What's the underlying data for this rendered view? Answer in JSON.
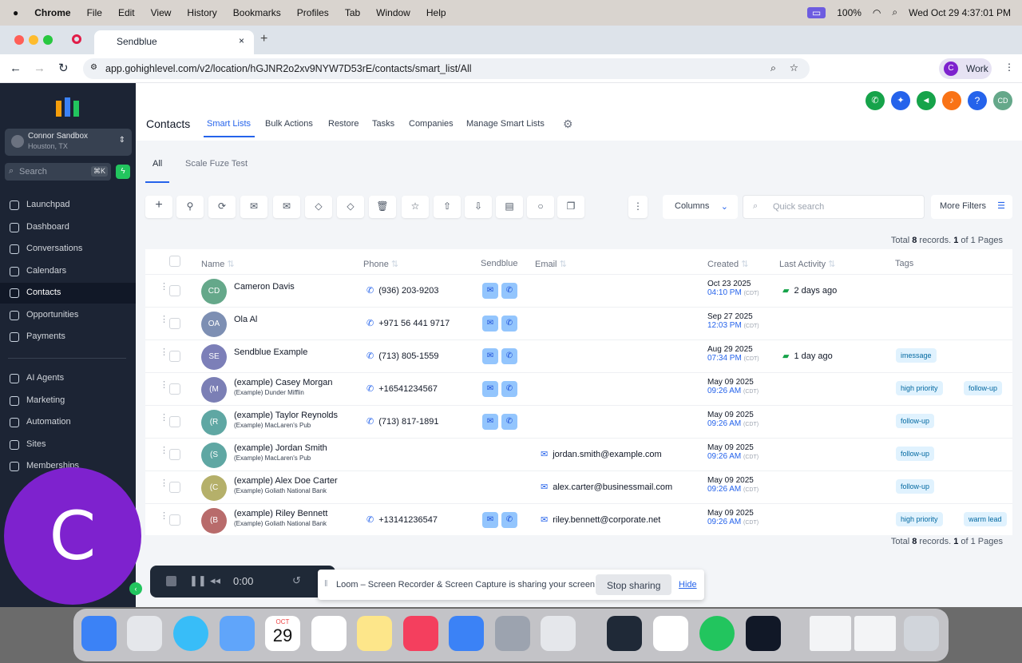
{
  "menubar": {
    "app": "Chrome",
    "items": [
      "File",
      "Edit",
      "View",
      "History",
      "Bookmarks",
      "Profiles",
      "Tab",
      "Window",
      "Help"
    ],
    "battery": "100%",
    "datetime": "Wed Oct 29  4:37:01 PM"
  },
  "browser": {
    "tab_title": "Sendblue",
    "url": "app.gohighlevel.com/v2/location/hGJNR2o2xv9NYW7D53rE/contacts/smart_list/All",
    "profile_letter": "C",
    "profile_label": "Work"
  },
  "sidebar": {
    "account_name": "Connor Sandbox",
    "account_location": "Houston, TX",
    "search_placeholder": "Search",
    "search_shortcut": "⌘K",
    "items": [
      "Launchpad",
      "Dashboard",
      "Conversations",
      "Calendars",
      "Contacts",
      "Opportunities",
      "Payments"
    ],
    "items2": [
      "AI Agents",
      "Marketing",
      "Automation",
      "Sites",
      "Memberships"
    ]
  },
  "header": {
    "title": "Contacts",
    "tabs": [
      "Smart Lists",
      "Bulk Actions",
      "Restore",
      "Tasks",
      "Companies",
      "Manage Smart Lists"
    ],
    "avatar": "CD"
  },
  "subtabs": [
    "All",
    "Scale Fuze Test"
  ],
  "toolbar": {
    "columns": "Columns",
    "quick_search": "Quick search",
    "more_filters": "More Filters"
  },
  "totals": {
    "prefix": "Total",
    "count": "8",
    "records": "records.",
    "page": "1",
    "of": "of 1 Pages"
  },
  "table": {
    "headers": [
      "Name",
      "Phone",
      "Sendblue",
      "Email",
      "Created",
      "Last Activity",
      "Tags"
    ],
    "rows": [
      {
        "initials": "CD",
        "color": "#65a88a",
        "name": "Cameron Davis",
        "company": "",
        "phone": "(936) 203-9203",
        "sendblue": true,
        "email": "",
        "date": "Oct 23 2025",
        "time": "04:10 PM",
        "tz": "(CDT)",
        "activity": "2 days ago",
        "tags": []
      },
      {
        "initials": "OA",
        "color": "#7d8fb3",
        "name": "Ola Al",
        "company": "",
        "phone": "+971 56 441 9717",
        "sendblue": true,
        "email": "",
        "date": "Sep 27 2025",
        "time": "12:03 PM",
        "tz": "(CDT)",
        "activity": "",
        "tags": []
      },
      {
        "initials": "SE",
        "color": "#7c7fb8",
        "name": "Sendblue Example",
        "company": "",
        "phone": "(713) 805-1559",
        "sendblue": true,
        "email": "",
        "date": "Aug 29 2025",
        "time": "07:34 PM",
        "tz": "(CDT)",
        "activity": "1 day ago",
        "tags": [
          "imessage"
        ]
      },
      {
        "initials": "(M",
        "color": "#7b7fb5",
        "name": "(example) Casey Morgan",
        "company": "(Example) Dunder Mifflin",
        "phone": "+16541234567",
        "sendblue": true,
        "email": "",
        "date": "May 09 2025",
        "time": "09:26 AM",
        "tz": "(CDT)",
        "activity": "",
        "tags": [
          "high priority",
          "follow-up"
        ]
      },
      {
        "initials": "(R",
        "color": "#5fa7a3",
        "name": "(example) Taylor Reynolds",
        "company": "(Example) MacLaren's Pub",
        "phone": "(713) 817-1891",
        "sendblue": true,
        "email": "",
        "date": "May 09 2025",
        "time": "09:26 AM",
        "tz": "(CDT)",
        "activity": "",
        "tags": [
          "follow-up"
        ]
      },
      {
        "initials": "(S",
        "color": "#5fa7a3",
        "name": "(example) Jordan Smith",
        "company": "(Example) MacLaren's Pub",
        "phone": "",
        "sendblue": false,
        "email": "jordan.smith@example.com",
        "date": "May 09 2025",
        "time": "09:26 AM",
        "tz": "(CDT)",
        "activity": "",
        "tags": [
          "follow-up"
        ]
      },
      {
        "initials": "(C",
        "color": "#b5b06a",
        "name": "(example) Alex Doe Carter",
        "company": "(Example) Goliath National Bank",
        "phone": "",
        "sendblue": false,
        "email": "alex.carter@businessmail.com",
        "date": "May 09 2025",
        "time": "09:26 AM",
        "tz": "(CDT)",
        "activity": "",
        "tags": [
          "follow-up"
        ]
      },
      {
        "initials": "(B",
        "color": "#b86b6b",
        "name": "(example) Riley Bennett",
        "company": "(Example) Goliath National Bank",
        "phone": "+13141236547",
        "sendblue": true,
        "email": "riley.bennett@corporate.net",
        "date": "May 09 2025",
        "time": "09:26 AM",
        "tz": "(CDT)",
        "activity": "",
        "tags": [
          "high priority",
          "warm lead"
        ]
      }
    ]
  },
  "loom": {
    "timer": "0:00",
    "share_text": "Loom – Screen Recorder & Screen Capture is sharing your screen.",
    "stop": "Stop sharing",
    "hide": "Hide",
    "bubble_letter": "C"
  },
  "dock": {
    "calendar_month": "OCT",
    "calendar_day": "29"
  }
}
